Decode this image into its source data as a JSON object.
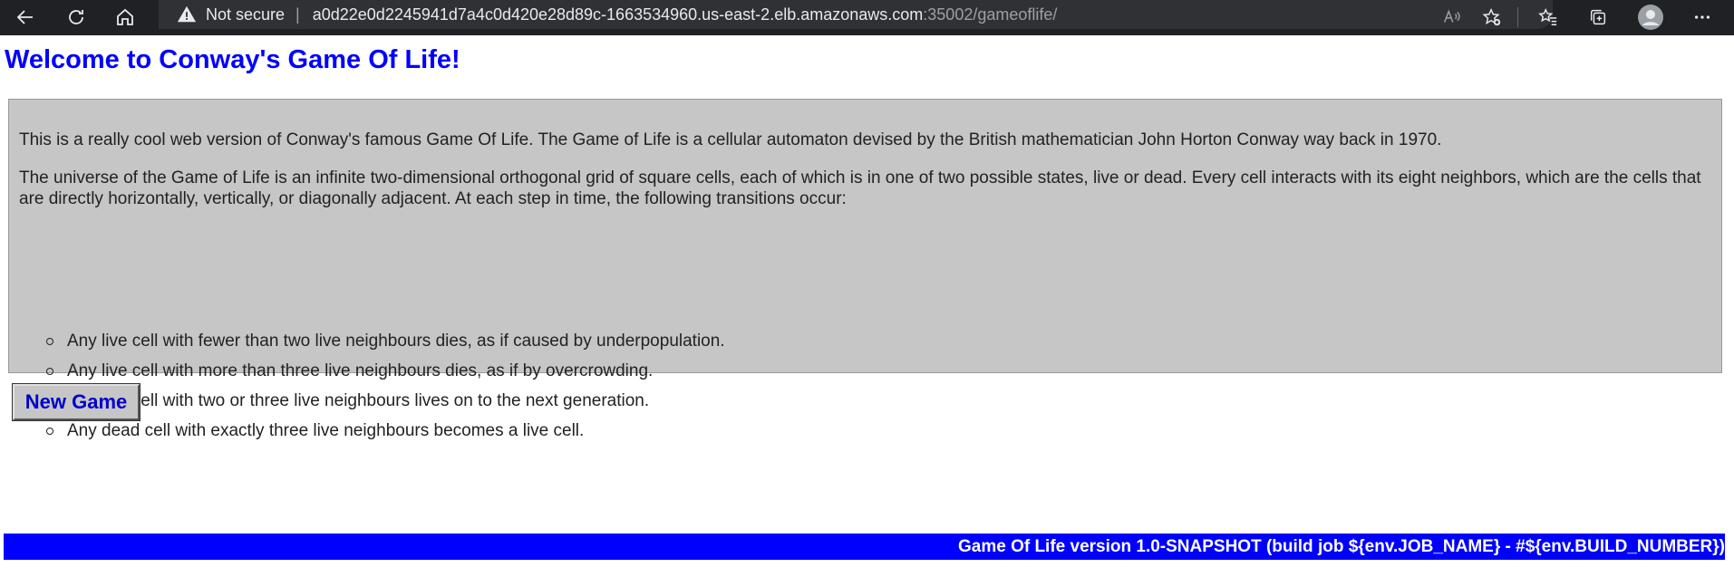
{
  "browser": {
    "security_label": "Not secure",
    "url_host": "a0d22e0d2245941d7a4c0d420e28d89c-1663534960.us-east-2.elb.amazonaws.com",
    "url_rest": ":35002/gameoflife/",
    "icons": [
      "back-icon",
      "reload-icon",
      "home-icon",
      "warning-icon",
      "read-aloud-icon",
      "add-favorite-icon",
      "favorites-icon",
      "collections-icon",
      "profile-icon",
      "more-icon"
    ]
  },
  "page": {
    "title": "Welcome to Conway's Game Of Life!",
    "intro": "This is a really cool web version of Conway's famous Game Of Life. The Game of Life is a cellular automaton devised by the British mathematician John Horton Conway way back in 1970.",
    "description": "The universe of the Game of Life is an infinite two-dimensional orthogonal grid of square cells, each of which is in one of two possible states, live or dead. Every cell interacts with its eight neighbors, which are the cells that are directly horizontally, vertically, or diagonally adjacent. At each step in time, the following transitions occur:",
    "rules": [
      "Any live cell with fewer than two live neighbours dies, as if caused by underpopulation.",
      "Any live cell with more than three live neighbours dies, as if by overcrowding.",
      "Any live cell with two or three live neighbours lives on to the next generation.",
      "Any dead cell with exactly three live neighbours becomes a live cell."
    ],
    "new_game_label": "New Game",
    "footer": "Game Of Life version 1.0-SNAPSHOT (build job ${env.JOB_NAME} - #${env.BUILD_NUMBER})"
  },
  "colors": {
    "title": "#0000ff",
    "footer_bg": "#0000ff",
    "box_bg": "#c6c6c6"
  }
}
